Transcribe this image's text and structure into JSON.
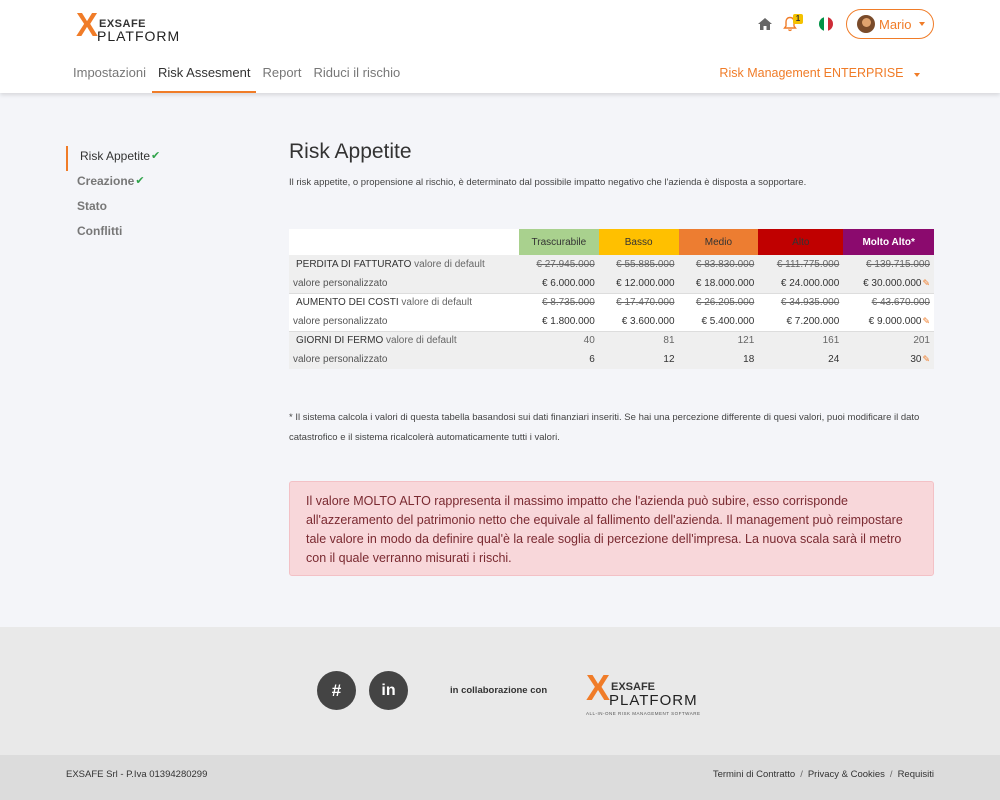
{
  "brand": {
    "exsafe": "EXSAFE",
    "platform": "PLATFORM",
    "tagline": "ALL-IN-ONE RISK MANAGEMENT SOFTWARE"
  },
  "header": {
    "notification_count": "1",
    "user_name": "Mario",
    "product": "Risk Management ENTERPRISE",
    "tabs": [
      "Impostazioni",
      "Risk Assesment",
      "Report",
      "Riduci il rischio"
    ],
    "active_tab": "Risk Assesment",
    "flag_colors": [
      "#009246",
      "#ffffff",
      "#ce2b37"
    ],
    "accent_color": "#f07c28"
  },
  "sidebar": {
    "items": [
      {
        "label": "Risk Appetite",
        "checked": true
      },
      {
        "label": "Creazione",
        "checked": true
      },
      {
        "label": "Stato",
        "checked": false
      },
      {
        "label": "Conflitti",
        "checked": false
      }
    ]
  },
  "main": {
    "title": "Risk Appetite",
    "subtitle": "Il risk appetite, o propensione al rischio, è determinato dal possibile impatto negativo che l'azienda è disposta a sopportare.",
    "levels": [
      {
        "label": "Trascurabile",
        "color": "#a9d18e"
      },
      {
        "label": "Basso",
        "color": "#ffc000"
      },
      {
        "label": "Medio",
        "color": "#ed7d31"
      },
      {
        "label": "Alto",
        "color": "#c00000"
      },
      {
        "label": "Molto Alto*",
        "color": "#8b0a6e"
      }
    ],
    "rows": [
      {
        "name": "PERDITA DI FATTURATO",
        "default_label": "valore di default",
        "custom_label": "valore personalizzato",
        "default": [
          "€ 27.945.000",
          "€ 55.885.000",
          "€ 83.830.000",
          "€ 111.775.000",
          "€ 139.715.000"
        ],
        "custom": [
          "€ 6.000.000",
          "€ 12.000.000",
          "€ 18.000.000",
          "€ 24.000.000",
          "€ 30.000.000"
        ]
      },
      {
        "name": "AUMENTO DEI COSTI",
        "default_label": "valore di default",
        "custom_label": "valore personalizzato",
        "default": [
          "€ 8.735.000",
          "€ 17.470.000",
          "€ 26.205.000",
          "€ 34.935.000",
          "€ 43.670.000"
        ],
        "custom": [
          "€ 1.800.000",
          "€ 3.600.000",
          "€ 5.400.000",
          "€ 7.200.000",
          "€ 9.000.000"
        ]
      },
      {
        "name": "GIORNI DI FERMO",
        "default_label": "valore di default",
        "custom_label": "valore personalizzato",
        "default": [
          "40",
          "81",
          "121",
          "161",
          "201"
        ],
        "custom": [
          "6",
          "12",
          "18",
          "24",
          "30"
        ]
      }
    ],
    "footnote": "* Il sistema calcola i valori di questa tabella basandosi sui dati finanziari inseriti. Se hai una percezione differente di quesi valori, puoi modificare il dato catastrofico e il sistema ricalcolerà automaticamente tutti i valori.",
    "alert": "Il valore MOLTO ALTO rappresenta il massimo impatto che l'azienda può subire, esso corrisponde all'azzeramento del patrimonio netto che equivale al fallimento dell'azienda. Il management può reimpostare tale valore in modo da definire qual'è la reale soglia di percezione dell'impresa. La nuova scala sarà il metro con il quale verranno misurati i rischi."
  },
  "footer": {
    "collab": "in collaborazione con",
    "company": "EXSAFE Srl - P.Iva 01394280299",
    "links": [
      "Termini di Contratto",
      "Privacy & Cookies",
      "Requisiti"
    ]
  }
}
